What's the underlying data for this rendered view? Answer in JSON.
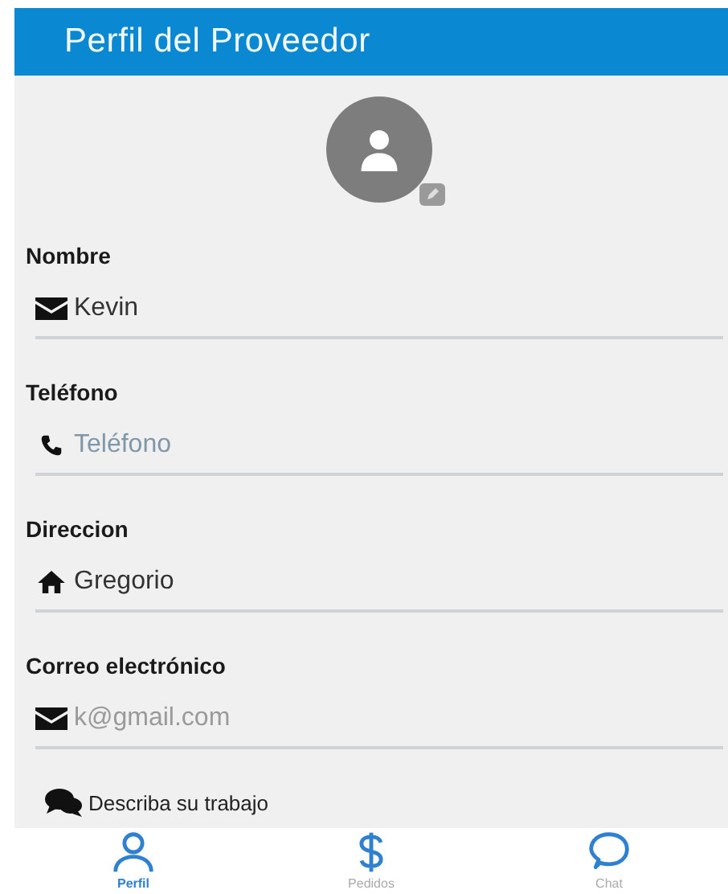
{
  "header": {
    "title": "Perfil del Proveedor"
  },
  "avatar": {
    "editable": true
  },
  "fields": [
    {
      "kind": "name",
      "label": "Nombre",
      "value": "Kevin"
    },
    {
      "kind": "phone",
      "label": "Teléfono",
      "placeholder": "Teléfono"
    },
    {
      "kind": "address",
      "label": "Direccion",
      "value": "Gregorio"
    },
    {
      "kind": "email",
      "label": "Correo electrónico",
      "placeholder": "k@gmail.com"
    }
  ],
  "description": {
    "label": "Describa su trabajo"
  },
  "tabs": [
    {
      "kind": "profile",
      "label": "Perfil",
      "selected": true
    },
    {
      "kind": "orders",
      "label": "Pedidos",
      "selected": false
    },
    {
      "kind": "chat",
      "label": "Chat",
      "selected": false
    }
  ]
}
